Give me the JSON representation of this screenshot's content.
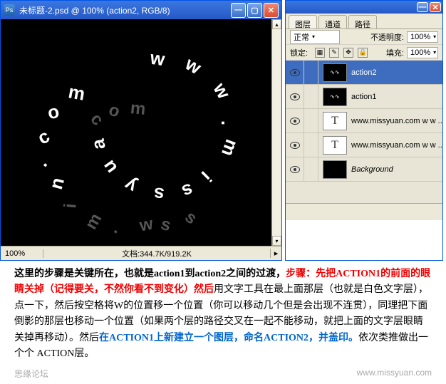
{
  "doc": {
    "title": "未标题-2.psd @ 100% (action2, RGB/8)",
    "canvas_text": "www.missyuan.com",
    "zoom": "100%",
    "status": "文档:344.7K/919.2K"
  },
  "win_controls": {
    "min": "—",
    "max": "▢",
    "close": "✕"
  },
  "panel": {
    "tabs": {
      "layers": "图层",
      "channels": "通道",
      "paths": "路径"
    },
    "blend_mode": "正常",
    "opacity_label": "不透明度:",
    "opacity_value": "100%",
    "lock_label": "锁定:",
    "fill_label": "填充:",
    "fill_value": "100%",
    "layers": [
      {
        "name": "action2",
        "selected": true,
        "type": "swirl"
      },
      {
        "name": "action1",
        "selected": false,
        "type": "swirl"
      },
      {
        "name": "www.missyuan.com  w w ...",
        "selected": false,
        "type": "text"
      },
      {
        "name": "www.missyuan.com  w w ...",
        "selected": false,
        "type": "text"
      },
      {
        "name": "Background",
        "selected": false,
        "type": "bg",
        "italic": true
      }
    ]
  },
  "instructions": {
    "t1": "这里的步骤是关键所在，也就是action1到action2之间的过渡，",
    "t2": "步骤：先把ACTION1的前面的眼睛关掉（记得要关，不然你看不到变化）然后",
    "t3": "用文字工具在最上面那层（也就是白色文字层），点一下，然后按空格将W的位置移一个位置（你可以移动几个但是会出现不连贯），同理把下面倒影的那层也移动一个位置（如果两个层的路径交叉在一起不能移动，就把上面的文字层眼睛关掉再移动）。然后",
    "t4": "在ACTION1上新建立一个图层，命名ACTION2，并盖印。",
    "t5": "依次类推做出一个个 ACTION层。"
  },
  "footer": {
    "left": "思缘论坛",
    "right": "www.missyuan.com"
  }
}
